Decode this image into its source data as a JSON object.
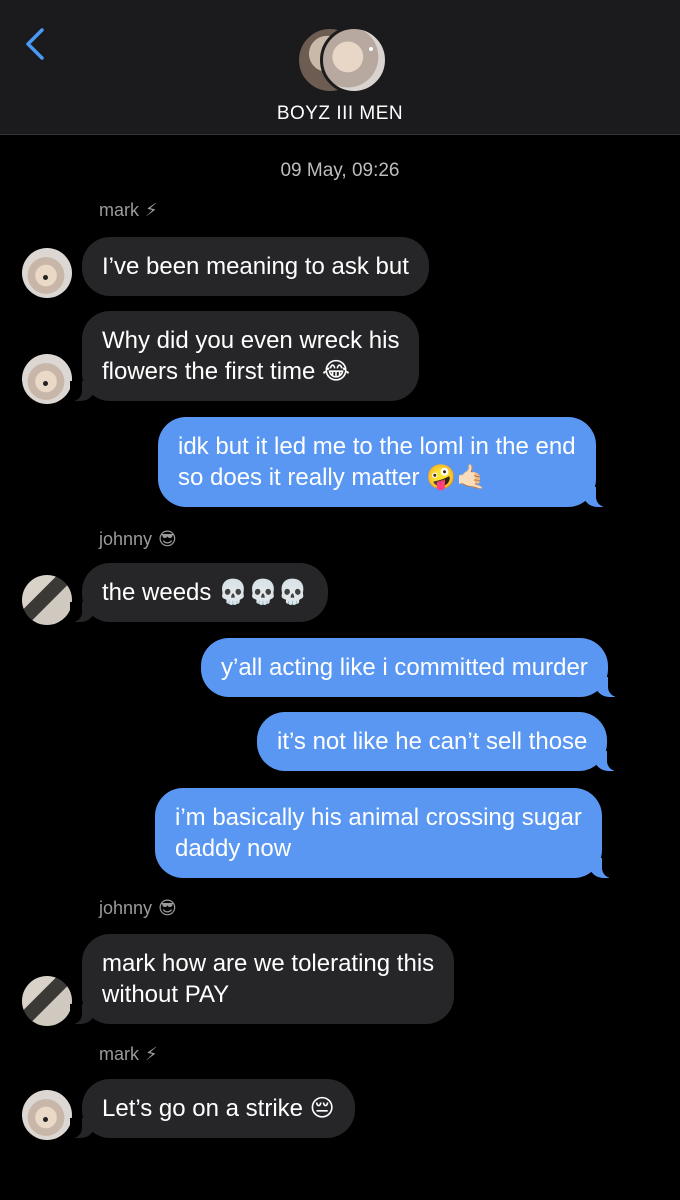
{
  "header": {
    "back_icon": "chevron-left-icon",
    "group_name": "BOYZ III MEN"
  },
  "timestamp": "09 May, 09:26",
  "messages": [
    {
      "sender": "mark",
      "sender_emoji": "⚡",
      "text": "I’ve been meaning to ask but",
      "direction": "incoming"
    },
    {
      "text": "Why did you even wreck his\nflowers the first time 😂",
      "direction": "incoming"
    },
    {
      "text": "idk but it led me to the loml in the end\nso does it really matter 🤪🤙🏻",
      "direction": "outgoing"
    },
    {
      "sender": "johnny",
      "sender_emoji": "😎",
      "text": "the weeds 💀💀💀",
      "direction": "incoming"
    },
    {
      "text": "y’all acting like i committed murder",
      "direction": "outgoing"
    },
    {
      "text": "it’s not like he can’t sell those",
      "direction": "outgoing"
    },
    {
      "text": "i’m basically his animal crossing sugar\ndaddy now",
      "direction": "outgoing"
    },
    {
      "sender": "johnny",
      "sender_emoji": "😎",
      "text": "mark how are we tolerating this\nwithout PAY",
      "direction": "incoming"
    },
    {
      "sender": "mark",
      "sender_emoji": "⚡",
      "text": "Let’s go on a strike 😔",
      "direction": "incoming"
    }
  ],
  "colors": {
    "background": "#000000",
    "header": "#1b1b1d",
    "incoming_bubble": "#262628",
    "outgoing_bubble": "#5a97f2",
    "accent": "#4a9af5"
  }
}
